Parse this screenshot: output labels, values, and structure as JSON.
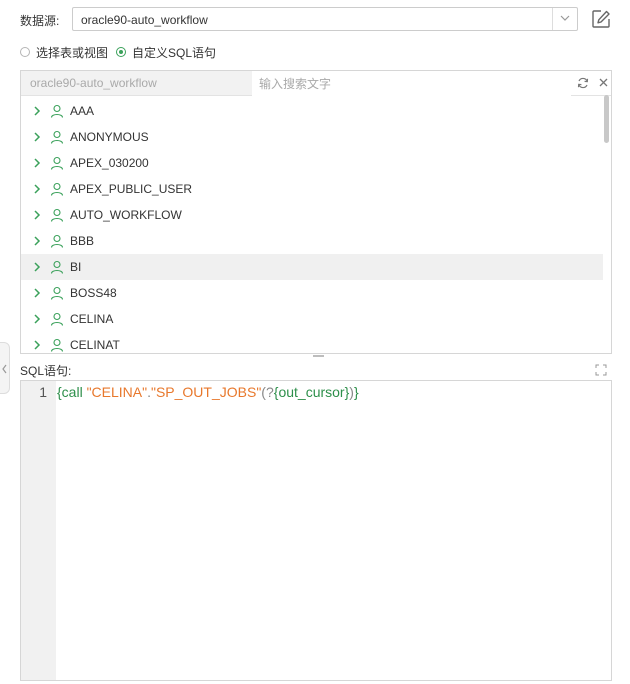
{
  "datasource": {
    "label": "数据源:",
    "selected": "oracle90-auto_workflow"
  },
  "mode": {
    "options": [
      {
        "label": "选择表或视图",
        "checked": false
      },
      {
        "label": "自定义SQL语句",
        "checked": true
      }
    ]
  },
  "tree": {
    "datasource_name": "oracle90-auto_workflow",
    "search_placeholder": "输入搜索文字",
    "items": [
      {
        "label": "AAA"
      },
      {
        "label": "ANONYMOUS"
      },
      {
        "label": "APEX_030200"
      },
      {
        "label": "APEX_PUBLIC_USER"
      },
      {
        "label": "AUTO_WORKFLOW"
      },
      {
        "label": "BBB"
      },
      {
        "label": "BI",
        "highlighted": true
      },
      {
        "label": "BOSS48"
      },
      {
        "label": "CELINA"
      },
      {
        "label": "CELINAT"
      }
    ]
  },
  "sql": {
    "label": "SQL语句:",
    "line_number": "1",
    "tokens": [
      {
        "text": "{call ",
        "color": "green"
      },
      {
        "text": "\"CELINA\"",
        "color": "orange"
      },
      {
        "text": ".",
        "color": "gray"
      },
      {
        "text": "\"SP_OUT_JOBS\"",
        "color": "orange"
      },
      {
        "text": "(",
        "color": "gray"
      },
      {
        "text": "?",
        "color": "gray"
      },
      {
        "text": "{out_cursor}",
        "color": "green"
      },
      {
        "text": ")",
        "color": "gray"
      },
      {
        "text": "}",
        "color": "green"
      }
    ]
  },
  "colors": {
    "accent_green": "#3ba15b",
    "sql_string_orange": "#e8782c",
    "row_highlight": "#f0f0f0"
  },
  "icons": {
    "edit": "edit-icon",
    "dropdown": "chevron-down-icon",
    "refresh": "refresh-icon",
    "close": "close-icon",
    "expand": "chevron-right-icon",
    "user": "user-icon",
    "fullscreen": "fullscreen-icon",
    "collapse": "chevron-left-icon"
  }
}
